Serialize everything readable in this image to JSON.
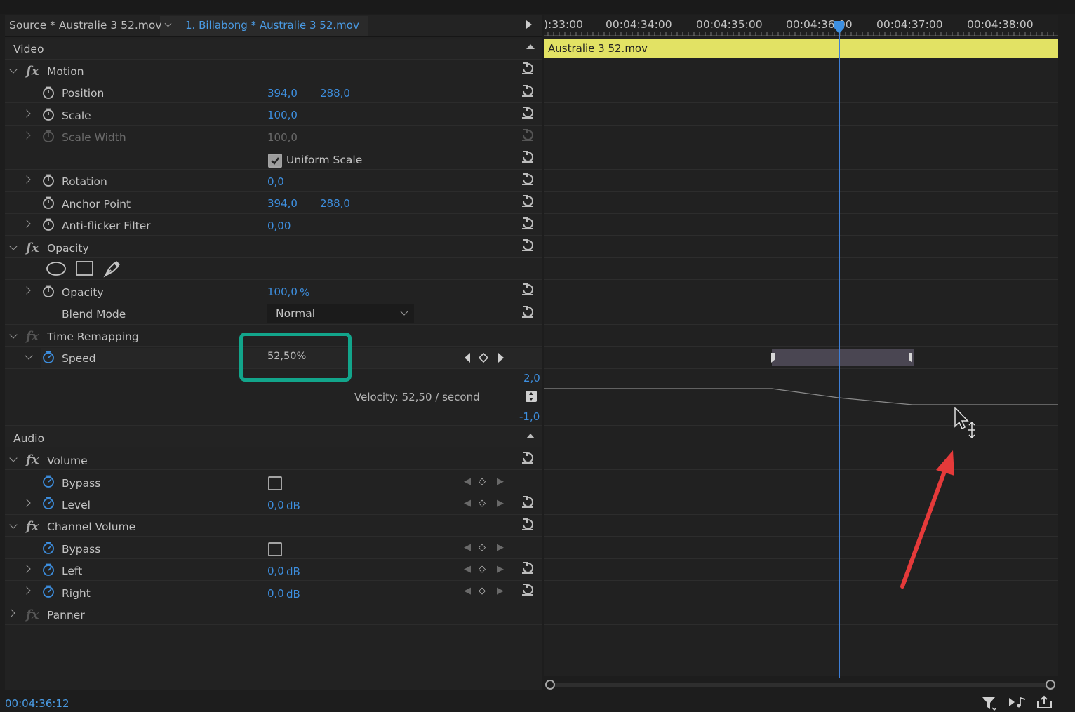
{
  "tabs": {
    "source": "Source * Australie 3 52.mov",
    "sequence": "1. Billabong * Australie 3 52.mov"
  },
  "ruler": {
    "timecodes": [
      "):33:00",
      "00:04:34:00",
      "00:04:35:00",
      "00:04:36:00",
      "00:04:37:00",
      "00:04:38:00"
    ]
  },
  "clip": {
    "name": "Australie 3 52.mov",
    "color": "#e2e264"
  },
  "sections": {
    "video": "Video",
    "audio": "Audio"
  },
  "motion": {
    "title": "Motion",
    "position": {
      "label": "Position",
      "x": "394,0",
      "y": "288,0"
    },
    "scale": {
      "label": "Scale",
      "value": "100,0"
    },
    "scale_width": {
      "label": "Scale Width",
      "value": "100,0"
    },
    "uniform_scale": {
      "label": "Uniform Scale",
      "checked": true
    },
    "rotation": {
      "label": "Rotation",
      "value": "0,0"
    },
    "anchor_point": {
      "label": "Anchor Point",
      "x": "394,0",
      "y": "288,0"
    },
    "anti_flicker": {
      "label": "Anti-flicker Filter",
      "value": "0,00"
    }
  },
  "opacity": {
    "title": "Opacity",
    "opacity": {
      "label": "Opacity",
      "value": "100,0",
      "unit": "%"
    },
    "blend_mode": {
      "label": "Blend Mode",
      "value": "Normal"
    }
  },
  "time_remapping": {
    "title": "Time Remapping",
    "speed": {
      "label": "Speed",
      "value": "52,50%"
    },
    "graph_max": "2,0",
    "graph_min": "-1,0",
    "velocity": "Velocity: 52,50 / second"
  },
  "volume": {
    "title": "Volume",
    "bypass": {
      "label": "Bypass"
    },
    "level": {
      "label": "Level",
      "value": "0,0",
      "unit": "dB"
    }
  },
  "channel_volume": {
    "title": "Channel Volume",
    "bypass": {
      "label": "Bypass"
    },
    "left": {
      "label": "Left",
      "value": "0,0",
      "unit": "dB"
    },
    "right": {
      "label": "Right",
      "value": "0,0",
      "unit": "dB"
    }
  },
  "panner": {
    "title": "Panner"
  },
  "footer": {
    "timecode": "00:04:36:12"
  },
  "colors": {
    "accent": "#3d8fe0",
    "highlight": "#12a58b",
    "arrow": "#e53a3a"
  }
}
